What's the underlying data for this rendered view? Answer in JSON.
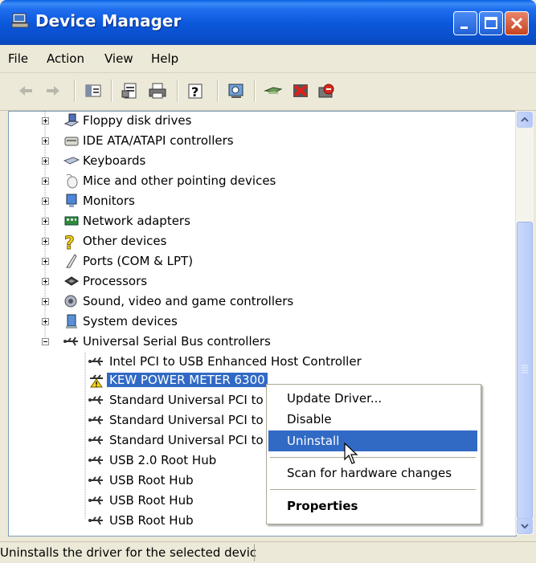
{
  "window": {
    "title": "Device Manager"
  },
  "menu": [
    "File",
    "Action",
    "View",
    "Help"
  ],
  "toolbar_icons": [
    "back-arrow-icon",
    "forward-arrow-icon",
    "console-tree-icon",
    "properties-icon",
    "print-icon",
    "help-icon",
    "scan-hardware-icon",
    "update-driver-icon",
    "uninstall-icon",
    "disable-icon"
  ],
  "tree": {
    "categories": [
      "Floppy disk drives",
      "IDE ATA/ATAPI controllers",
      "Keyboards",
      "Mice and other pointing devices",
      "Monitors",
      "Network adapters",
      "Other devices",
      "Ports (COM & LPT)",
      "Processors",
      "Sound, video and game controllers",
      "System devices",
      "Universal Serial Bus controllers"
    ],
    "usb_children": [
      "Intel PCI to USB Enhanced Host Controller",
      "KEW POWER METER 6300",
      "Standard Universal PCI to",
      "Standard Universal PCI to",
      "Standard Universal PCI to",
      "USB 2.0 Root Hub",
      "USB Root Hub",
      "USB Root Hub",
      "USB Root Hub"
    ],
    "selected": "KEW POWER METER 6300"
  },
  "context_menu": {
    "update": "Update Driver...",
    "disable": "Disable",
    "uninstall": "Uninstall",
    "scan": "Scan for hardware changes",
    "properties": "Properties"
  },
  "status": "Uninstalls the driver for the selected devic",
  "colors": {
    "title_blue": "#0B56D9",
    "selection": "#316AC5",
    "chrome": "#ECE9D8"
  }
}
